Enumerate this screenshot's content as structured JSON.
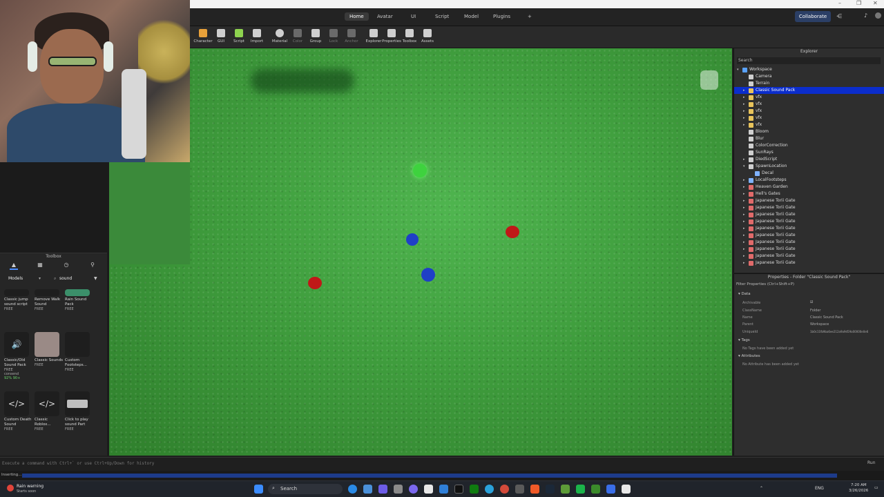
{
  "window_controls": {
    "minimize": "–",
    "maximize": "❐",
    "close": "✕"
  },
  "menu_tabs": [
    {
      "label": "Home",
      "active": true
    },
    {
      "label": "Avatar"
    },
    {
      "label": "UI"
    },
    {
      "label": "Script"
    },
    {
      "label": "Model"
    },
    {
      "label": "Plugins"
    },
    {
      "label": "+"
    }
  ],
  "collaborate_label": "Collaborate",
  "ribbon_tools": [
    {
      "label": "Character"
    },
    {
      "label": "GUI"
    },
    {
      "label": "Script"
    },
    {
      "label": "Import"
    },
    {
      "label": "Material"
    },
    {
      "label": "Color"
    },
    {
      "label": "Group"
    },
    {
      "label": "Lock"
    },
    {
      "label": "Anchor"
    },
    {
      "label": "Explorer"
    },
    {
      "label": "Properties"
    },
    {
      "label": "Toolbox"
    },
    {
      "label": "Assets"
    }
  ],
  "toolbox": {
    "title": "Toolbox",
    "category": "Models",
    "query": "sound",
    "assets": [
      {
        "name": "Classic jump sound script",
        "price": "FREE"
      },
      {
        "name": "Remove Walk Sound",
        "price": "FREE"
      },
      {
        "name": "Rain Sound Pack",
        "price": "FREE"
      },
      {
        "name": "Classic/Old Sound Pack",
        "price": "FREE",
        "creator": "consend",
        "rating": "92% 90+"
      },
      {
        "name": "Classic Sounds",
        "price": "FREE"
      },
      {
        "name": "Custom Footsteps...",
        "price": "FREE"
      },
      {
        "name": "Custom Death Sound",
        "price": "FREE"
      },
      {
        "name": "Classic Roblox...",
        "price": "FREE"
      },
      {
        "name": "Click to play sound Part",
        "price": "FREE"
      }
    ]
  },
  "explorer": {
    "title": "Explorer",
    "search_placeholder": "Search",
    "items": [
      {
        "label": "Workspace",
        "depth": 0,
        "icon": "workspace-icon",
        "color": "#5aa2ff",
        "expanded": true
      },
      {
        "label": "Camera",
        "depth": 1,
        "icon": "camera-icon",
        "color": "#cfcfcf"
      },
      {
        "label": "Terrain",
        "depth": 1,
        "icon": "terrain-icon",
        "color": "#cfcfcf"
      },
      {
        "label": "Classic Sound Pack",
        "depth": 1,
        "icon": "folder-icon",
        "color": "#e8c35b",
        "selected": true,
        "collapsed": true
      },
      {
        "label": "vfx",
        "depth": 1,
        "icon": "folder-icon",
        "color": "#e8c35b",
        "collapsed": true
      },
      {
        "label": "vfx",
        "depth": 1,
        "icon": "folder-icon",
        "color": "#e8c35b",
        "collapsed": true
      },
      {
        "label": "vfx",
        "depth": 1,
        "icon": "folder-icon",
        "color": "#e8c35b",
        "collapsed": true
      },
      {
        "label": "vfx",
        "depth": 1,
        "icon": "folder-icon",
        "color": "#e8c35b",
        "collapsed": true
      },
      {
        "label": "vfx",
        "depth": 1,
        "icon": "folder-icon",
        "color": "#e8c35b",
        "collapsed": true
      },
      {
        "label": "Bloom",
        "depth": 1,
        "icon": "bloom-icon",
        "color": "#cfcfcf"
      },
      {
        "label": "Blur",
        "depth": 1,
        "icon": "blur-icon",
        "color": "#cfcfcf"
      },
      {
        "label": "ColorCorrection",
        "depth": 1,
        "icon": "color-correction-icon",
        "color": "#cfcfcf"
      },
      {
        "label": "SunRays",
        "depth": 1,
        "icon": "sunrays-icon",
        "color": "#cfcfcf"
      },
      {
        "label": "DiedScript",
        "depth": 1,
        "icon": "script-icon",
        "color": "#cfcfcf",
        "collapsed": true
      },
      {
        "label": "SpawnLocation",
        "depth": 1,
        "icon": "spawn-icon",
        "color": "#cfcfcf",
        "expanded": true
      },
      {
        "label": "Decal",
        "depth": 2,
        "icon": "decal-icon",
        "color": "#7fb2ff"
      },
      {
        "label": "LocalFootsteps",
        "depth": 1,
        "icon": "localscript-icon",
        "color": "#7fb2ff",
        "collapsed": true
      },
      {
        "label": "Heaven Garden",
        "depth": 1,
        "icon": "model-icon",
        "color": "#e06a6a",
        "collapsed": true
      },
      {
        "label": "Hell's Gates",
        "depth": 1,
        "icon": "model-icon",
        "color": "#e06a6a",
        "collapsed": true
      },
      {
        "label": "Japanese Torii Gate",
        "depth": 1,
        "icon": "model-icon",
        "color": "#e06a6a",
        "collapsed": true
      },
      {
        "label": "Japanese Torii Gate",
        "depth": 1,
        "icon": "model-icon",
        "color": "#e06a6a",
        "collapsed": true
      },
      {
        "label": "Japanese Torii Gate",
        "depth": 1,
        "icon": "model-icon",
        "color": "#e06a6a",
        "collapsed": true
      },
      {
        "label": "Japanese Torii Gate",
        "depth": 1,
        "icon": "model-icon",
        "color": "#e06a6a",
        "collapsed": true
      },
      {
        "label": "Japanese Torii Gate",
        "depth": 1,
        "icon": "model-icon",
        "color": "#e06a6a",
        "collapsed": true
      },
      {
        "label": "Japanese Torii Gate",
        "depth": 1,
        "icon": "model-icon",
        "color": "#e06a6a",
        "collapsed": true
      },
      {
        "label": "Japanese Torii Gate",
        "depth": 1,
        "icon": "model-icon",
        "color": "#e06a6a",
        "collapsed": true
      },
      {
        "label": "Japanese Torii Gate",
        "depth": 1,
        "icon": "model-icon",
        "color": "#e06a6a",
        "collapsed": true
      },
      {
        "label": "Japanese Torii Gate",
        "depth": 1,
        "icon": "model-icon",
        "color": "#e06a6a",
        "collapsed": true
      },
      {
        "label": "Japanese Torii Gate",
        "depth": 1,
        "icon": "model-icon",
        "color": "#e06a6a",
        "collapsed": true
      }
    ]
  },
  "properties": {
    "title": "Properties - Folder \"Classic Sound Pack\"",
    "filter_placeholder": "Filter Properties (Ctrl+Shift+P)",
    "sections": {
      "data": "Data",
      "tags": "Tags",
      "attributes": "Attributes"
    },
    "rows": [
      {
        "name": "Archivable",
        "value": "☑"
      },
      {
        "name": "ClassName",
        "value": "Folder"
      },
      {
        "name": "Name",
        "value": "Classic Sound Pack"
      },
      {
        "name": "Parent",
        "value": "Workspace"
      },
      {
        "name": "UniqueId",
        "value": "1b0c11fb9ba6ee212a9a9d59a00000e0e6"
      }
    ],
    "no_tags": "No Tags have been added yet",
    "no_attributes": "No Attribute has been added yet"
  },
  "command_bar": {
    "placeholder": "Execute a command with Ctrl+` or use Ctrl+Up/Down for history",
    "run_label": "Run"
  },
  "status": {
    "text": "Inserting..."
  },
  "taskbar": {
    "weather_title": "Rain warning",
    "weather_sub": "Starts soon",
    "search_label": "Search",
    "lang": "ENG",
    "time": "7:20 AM",
    "date": "3/26/2026"
  },
  "viewport": {
    "balls": [
      {
        "color": "#3ed23e"
      },
      {
        "color": "#1f3fc7"
      },
      {
        "color": "#c01818"
      },
      {
        "color": "#1f3fc7"
      },
      {
        "color": "#c01818"
      }
    ]
  }
}
